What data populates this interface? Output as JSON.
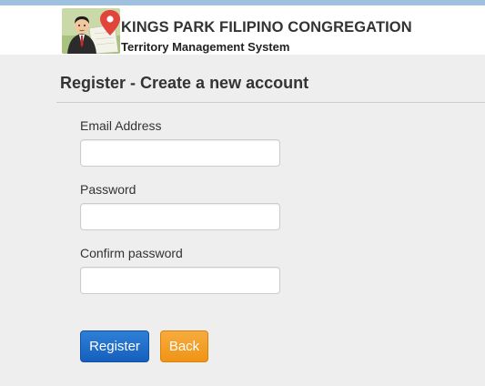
{
  "header": {
    "org_title": "KINGS PARK FILIPINO CONGREGATION",
    "subtitle": "Territory Management System",
    "logo_icon": "person-map-pin-logo-icon"
  },
  "form": {
    "title": "Register - Create a new account",
    "email": {
      "label": "Email Address",
      "value": "",
      "placeholder": ""
    },
    "password": {
      "label": "Password",
      "value": "",
      "placeholder": ""
    },
    "confirm_password": {
      "label": "Confirm password",
      "value": "",
      "placeholder": ""
    }
  },
  "actions": {
    "register_label": "Register",
    "back_label": "Back"
  },
  "colors": {
    "page_background": "#eeeeee",
    "header_background": "#ffffff",
    "top_strip": "#9fc0de",
    "register_button": "#1a68c6",
    "back_button": "#f39c1e"
  }
}
